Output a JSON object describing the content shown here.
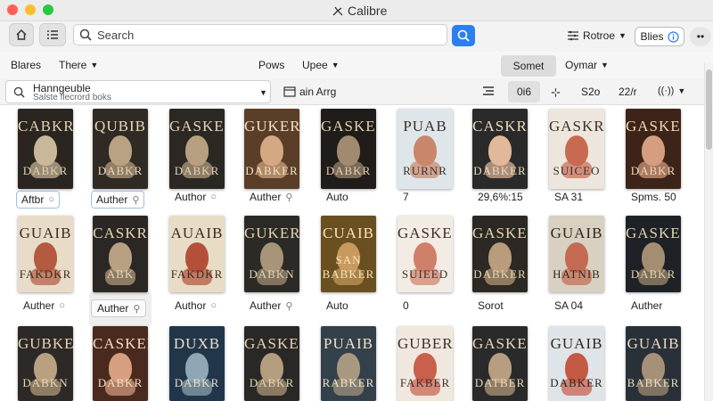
{
  "window": {
    "title": "Calibre"
  },
  "toolbar": {
    "search_placeholder": "Search",
    "rotree_label": "Rotroe",
    "blies_label": "Blies"
  },
  "row2": {
    "blares": "Blares",
    "there": "There",
    "pows": "Pows",
    "upee": "Upee",
    "sort": "Somet",
    "oymar": "Oymar"
  },
  "row3": {
    "library_title": "Hanngeuble",
    "library_sub": "Salste flecrord boks",
    "ain_arrg": "ain Arrg",
    "count": "0i6",
    "size": "S2o",
    "ratio": "22/r"
  },
  "books": {
    "row1": [
      {
        "title": "CABKR",
        "sub": "DABKR",
        "label": "Aftbr",
        "bg": "#2a2520",
        "fg": "#e2d2b0",
        "face": "#c9b79a"
      },
      {
        "title": "QUBIB",
        "sub": "DABKR",
        "label": "Auther",
        "bg": "#2f2a24",
        "fg": "#e8d8b8",
        "face": "#b9a282"
      },
      {
        "title": "GASKER",
        "sub": "DABKR",
        "label": "Author",
        "bg": "#2b2824",
        "fg": "#e4d4b4",
        "face": "#b7a080"
      },
      {
        "title": "GUKER",
        "sub": "DABKER",
        "label": "Auther",
        "bg": "#5a3e28",
        "fg": "#f4e2c4",
        "face": "#d4a882"
      },
      {
        "title": "GASKER",
        "sub": "DABKR",
        "label": "Auto",
        "bg": "#1f1c1a",
        "fg": "#e4d2ae",
        "face": "#a08a70"
      },
      {
        "title": "PUAB",
        "sub": "RURNR",
        "label": "7",
        "bg": "#dfe6ea",
        "fg": "#3a3028",
        "face": "#c9866a"
      },
      {
        "title": "CASKR",
        "sub": "DABKER",
        "label": "29,6%:15",
        "bg": "#2a2a2a",
        "fg": "#ecdcbc",
        "face": "#e1b89a"
      },
      {
        "title": "GASKR",
        "sub": "SUICEO",
        "label": "SA 31",
        "bg": "#ede6dc",
        "fg": "#3a3028",
        "face": "#c86a52"
      },
      {
        "title": "GASKER",
        "sub": "DABKR",
        "label": "Spms. 50",
        "bg": "#3c2418",
        "fg": "#f0d8b8",
        "face": "#d69e80"
      }
    ],
    "row2": [
      {
        "title": "GUAIB",
        "sub": "FAKDKR",
        "label": "Auther",
        "bg": "#e8dcc8",
        "fg": "#3a2c20",
        "face": "#b45a40"
      },
      {
        "title": "CASKR",
        "sub": "ABK",
        "label": "Auther",
        "bg": "#2a2724",
        "fg": "#e8d6b4",
        "face": "#b8a082"
      },
      {
        "title": "AUAIB",
        "sub": "FAKDKR",
        "label": "Author",
        "bg": "#e8dcc6",
        "fg": "#3a2c20",
        "face": "#b4503a"
      },
      {
        "title": "GUKER",
        "sub": "DABKN",
        "label": "Auther",
        "bg": "#2c2a26",
        "fg": "#e4d4b2",
        "face": "#a89478"
      },
      {
        "title": "CUAIB",
        "sub": "SAN BABKER",
        "label": "Auto",
        "bg": "#6a5020",
        "fg": "#f6e6b8",
        "face": "#c89a5e"
      },
      {
        "title": "GASKER",
        "sub": "SUIEED",
        "label": "0",
        "bg": "#f2ece4",
        "fg": "#3a3028",
        "face": "#d08068"
      },
      {
        "title": "GASKER",
        "sub": "DABKER",
        "label": "Sorot",
        "bg": "#2c2924",
        "fg": "#e6d4b0",
        "face": "#b89c7c"
      },
      {
        "title": "GUAIB",
        "sub": "HATNIB",
        "label": "SA 04",
        "bg": "#d8d0c0",
        "fg": "#2e2820",
        "face": "#c46a52"
      },
      {
        "title": "GASKER",
        "sub": "DABKR",
        "label": "Auther",
        "bg": "#1e2226",
        "fg": "#e4d2ae",
        "face": "#a48e72"
      }
    ],
    "row3": [
      {
        "title": "GUBKER",
        "sub": "DABKN",
        "bg": "#2c2926",
        "fg": "#e6d6b4",
        "face": "#b8a080"
      },
      {
        "title": "CASKER",
        "sub": "DABKR",
        "bg": "#4a2a1e",
        "fg": "#f4dcc0",
        "face": "#d6a080"
      },
      {
        "title": "DUXB",
        "sub": "DABKR",
        "bg": "#22364a",
        "fg": "#e8e0cc",
        "face": "#8fa6b4"
      },
      {
        "title": "GASKER",
        "sub": "DABKR",
        "bg": "#2a2826",
        "fg": "#e4d4b2",
        "face": "#b49c7e"
      },
      {
        "title": "PUAIB",
        "sub": "RABKER",
        "bg": "#34404a",
        "fg": "#f0e4c8",
        "face": "#a89880"
      },
      {
        "title": "GUBER",
        "sub": "FAKBER",
        "bg": "#f0e8de",
        "fg": "#3a3028",
        "face": "#c8604c"
      },
      {
        "title": "GASKER",
        "sub": "DATBER",
        "bg": "#2a2a2a",
        "fg": "#e8d8b8",
        "face": "#b89e80"
      },
      {
        "title": "GUAIB",
        "sub": "DABKER",
        "bg": "#dfe4e8",
        "fg": "#2e2820",
        "face": "#c45a44"
      },
      {
        "title": "GUAIB",
        "sub": "BABKER",
        "bg": "#2a3038",
        "fg": "#e8dcc0",
        "face": "#a69078"
      }
    ]
  },
  "colors": {
    "accent": "#2d7ff0",
    "close": "#ff5f57",
    "minimize": "#febc2e",
    "zoom": "#28c840"
  }
}
